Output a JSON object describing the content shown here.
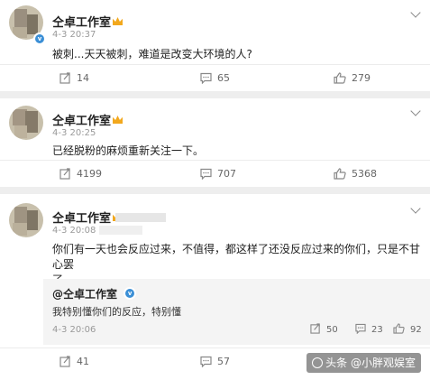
{
  "colors": {
    "verified_badge": "#3b8fd6",
    "crown": "#f2a81d",
    "watermark_bg": "rgba(60,60,60,0.55)"
  },
  "posts": [
    {
      "author": "仝卓工作室",
      "time": "4-3 20:37",
      "text": "被刺...天天被刺，难道是改变大环境的人?",
      "repost": "14",
      "comment": "65",
      "like": "279"
    },
    {
      "author": "仝卓工作室",
      "time": "4-3 20:25",
      "text": "已经脱粉的麻烦重新关注一下。",
      "repost": "4199",
      "comment": "707",
      "like": "5368"
    },
    {
      "author": "仝卓工作室",
      "time": "4-3 20:08",
      "text_line1": "你们有一天也会反应过来，不值得，都这样了还没反应过来的你们，只是不甘心罢",
      "text_line2": "了",
      "repost": "41",
      "comment": "57",
      "reply": {
        "name": "@仝卓工作室",
        "text": "我特别懂你们的反应，特别懂",
        "time": "4-3 20:06",
        "repost": "50",
        "comment": "23",
        "like": "92"
      }
    }
  ],
  "watermark": {
    "text": "头条 @小胖观娱室"
  },
  "icons": {
    "repost": "repost-icon",
    "comment": "comment-icon",
    "like": "thumbs-up-icon",
    "more": "chevron-down-icon",
    "verified": "verified-badge-icon",
    "crown": "crown-icon"
  }
}
